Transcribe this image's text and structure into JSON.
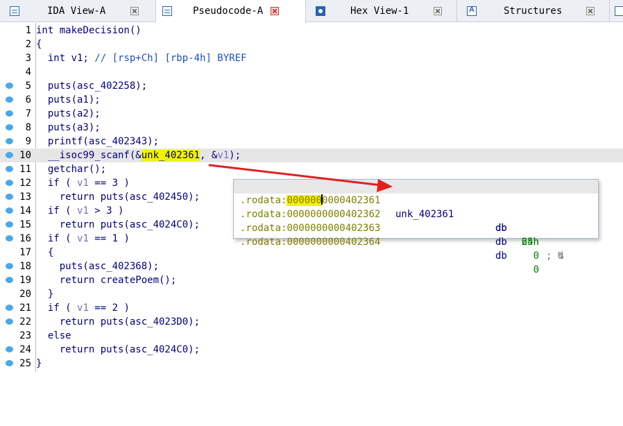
{
  "tabs": [
    {
      "label": "IDA View-A",
      "icon": "disassembly-view-icon",
      "active": false
    },
    {
      "label": "Pseudocode-A",
      "icon": "pseudocode-icon",
      "active": true
    },
    {
      "label": "Hex View-1",
      "icon": "hex-view-icon",
      "active": false
    },
    {
      "label": "Structures",
      "icon": "structures-icon",
      "active": false
    }
  ],
  "code": {
    "lines": [
      {
        "n": "1",
        "bp": false
      },
      {
        "n": "2",
        "bp": false
      },
      {
        "n": "3",
        "bp": false
      },
      {
        "n": "4",
        "bp": false
      },
      {
        "n": "5",
        "bp": true
      },
      {
        "n": "6",
        "bp": true
      },
      {
        "n": "7",
        "bp": true
      },
      {
        "n": "8",
        "bp": true
      },
      {
        "n": "9",
        "bp": true
      },
      {
        "n": "10",
        "bp": true
      },
      {
        "n": "11",
        "bp": true
      },
      {
        "n": "12",
        "bp": true
      },
      {
        "n": "13",
        "bp": true
      },
      {
        "n": "14",
        "bp": true
      },
      {
        "n": "15",
        "bp": true
      },
      {
        "n": "16",
        "bp": true
      },
      {
        "n": "17",
        "bp": false
      },
      {
        "n": "18",
        "bp": true
      },
      {
        "n": "19",
        "bp": true
      },
      {
        "n": "20",
        "bp": false
      },
      {
        "n": "21",
        "bp": true
      },
      {
        "n": "22",
        "bp": true
      },
      {
        "n": "23",
        "bp": false
      },
      {
        "n": "24",
        "bp": true
      },
      {
        "n": "25",
        "bp": true
      }
    ],
    "text": {
      "l1": "int makeDecision()",
      "l2": "{",
      "l3_decl": "  int v1; ",
      "l3_comment": "// [rsp+Ch] [rbp-4h] BYREF",
      "l4": "",
      "l5": "  puts(asc_402258);",
      "l6": "  puts(a1);",
      "l7": "  puts(a2);",
      "l8": "  puts(a3);",
      "l9": "  printf(asc_402343);",
      "l10_pre": "  __isoc99_scanf(&",
      "l10_hl": "unk_402361",
      "l10_mid": ", &",
      "l10_var": "v1",
      "l10_post": ");",
      "l11": "  getchar();",
      "l12_pre": "  if ( ",
      "l12_var": "v1",
      "l12_post": " == 3 )",
      "l13": "    return puts(asc_402450);",
      "l14_pre": "  if ( ",
      "l14_var": "v1",
      "l14_post": " > 3 )",
      "l15": "    return puts(asc_4024C0);",
      "l16_pre": "  if ( ",
      "l16_var": "v1",
      "l16_post": " == 1 )",
      "l17": "  {",
      "l18": "    puts(asc_402368);",
      "l19": "    return createPoem();",
      "l20": "  }",
      "l21_pre": "  if ( ",
      "l21_var": "v1",
      "l21_post": " == 2 )",
      "l22": "    return puts(asc_4023D0);",
      "l23": "  else",
      "l24": "    return puts(asc_4024C0);",
      "l25": "}"
    }
  },
  "popup": {
    "rows": [
      {
        "segment": ".rodata:",
        "addr_a": "000000",
        "addr_b": "0000402361",
        "label": "unk_402361",
        "db": "db",
        "value": "25h",
        "comment": "; %"
      },
      {
        "segment": ".rodata:",
        "addr": "0000000000402362",
        "label": "",
        "db": "db",
        "value": "64h",
        "comment": "; d"
      },
      {
        "segment": ".rodata:",
        "addr": "0000000000402363",
        "label": "",
        "db": "db",
        "value": "0",
        "comment": ""
      },
      {
        "segment": ".rodata:",
        "addr": "0000000000402364",
        "label": "",
        "db": "db",
        "value": "0",
        "comment": ""
      }
    ]
  },
  "colors": {
    "arrow": "#e02020",
    "highlight": "#f2f200",
    "code_text": "#000080",
    "comment": "#1e4fbf",
    "breakpoint_dot": "#4aa8e8"
  }
}
